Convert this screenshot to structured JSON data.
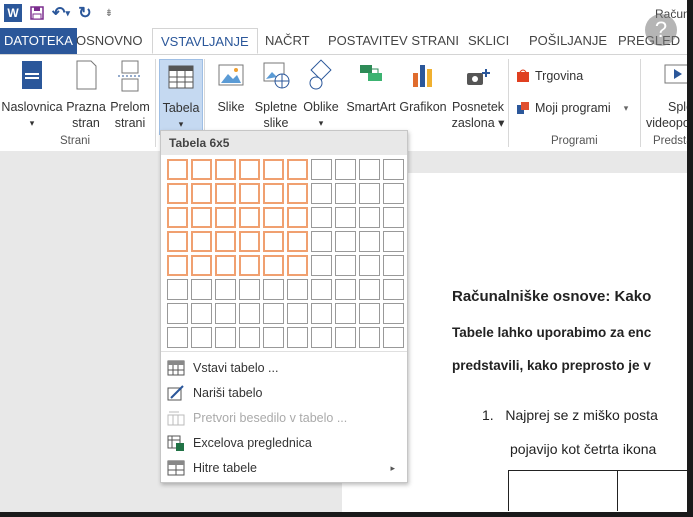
{
  "window": {
    "doc_title": "Računa",
    "app_logo": "W",
    "help_glyph": "?"
  },
  "qat": {
    "save_icon": "save-icon",
    "undo_icon": "undo-icon",
    "redo_icon": "redo-icon",
    "undo_glyph": "↶",
    "undo_dropdown": "▾",
    "redo_glyph": "↻",
    "customize_glyph": "⇟"
  },
  "tabs": [
    {
      "label": "DATOTEKA"
    },
    {
      "label": "OSNOVNO"
    },
    {
      "label": "VSTAVLJANJE"
    },
    {
      "label": "NAČRT"
    },
    {
      "label": "POSTAVITEV STRANI"
    },
    {
      "label": "SKLICI"
    },
    {
      "label": "POŠILJANJE"
    },
    {
      "label": "PREGLED"
    }
  ],
  "ribbon": {
    "pages": {
      "naslovnica": [
        "Naslovnica",
        "▾"
      ],
      "prazna": [
        "Prazna",
        "stran"
      ],
      "prelom": [
        "Prelom",
        "strani"
      ],
      "group_label": "Strani"
    },
    "tabela": {
      "label": "Tabela",
      "arrow": "▾"
    },
    "illustrations": {
      "slike": "Slike",
      "spletne": [
        "Spletne",
        "slike"
      ],
      "oblike": [
        "Oblike",
        "▾"
      ],
      "smartart": "SmartArt",
      "grafikon": "Grafikon",
      "posnetek": [
        "Posnetek",
        "zaslona ▾"
      ]
    },
    "apps": {
      "trgovina": "Trgovina",
      "moji_programi": "Moji programi",
      "arrow": "▾",
      "group_label": "Programi"
    },
    "media": {
      "label": [
        "Sple",
        "videopo"
      ],
      "group_label": "Predsta"
    }
  },
  "dropdown": {
    "header": "Tabela 6x5",
    "grid": {
      "cols": 10,
      "rows": 8,
      "selected_cols": 6,
      "selected_rows": 5
    },
    "items": [
      {
        "label": "Vstavi tabelo ...",
        "icon": "insert-table-icon",
        "disabled": false
      },
      {
        "label": "Nariši tabelo",
        "icon": "draw-table-icon",
        "disabled": false
      },
      {
        "label": "Pretvori besedilo v tabelo ...",
        "icon": "convert-text-icon",
        "disabled": true
      },
      {
        "label": "Excelova preglednica",
        "icon": "excel-sheet-icon",
        "disabled": false
      },
      {
        "label": "Hitre tabele",
        "icon": "quick-tables-icon",
        "disabled": false,
        "submenu": "▸"
      }
    ]
  },
  "document": {
    "heading": "Računalniške osnove: Kako",
    "para_line1": "Tabele lahko uporabimo za enc",
    "para_line2": "predstavili, kako preprosto je v",
    "list_item_number": "1.",
    "list_item_line1": "Najprej se z miško posta",
    "list_item_line2": "pojavijo kot četrta ikona"
  },
  "colors": {
    "accent": "#2b579a",
    "grid_highlight": "#f0a070",
    "selected_button": "#c5d9f1"
  }
}
